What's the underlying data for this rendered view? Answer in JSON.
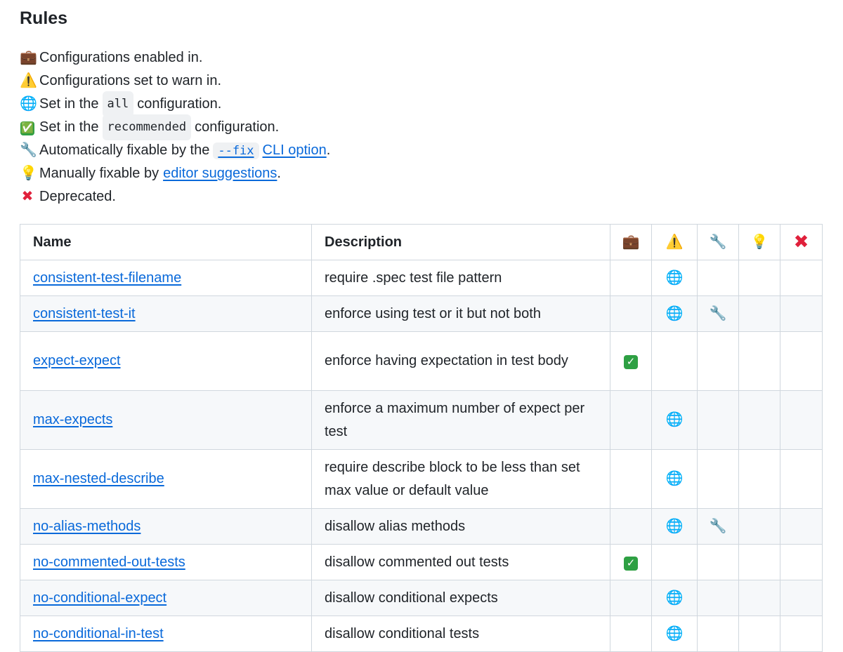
{
  "title": "Rules",
  "legend": [
    {
      "icon": "💼",
      "text": "Configurations enabled in."
    },
    {
      "icon": "⚠️",
      "text": "Configurations set to warn in."
    },
    {
      "icon": "🌐",
      "pre": "Set in the",
      "code": "all",
      "post": "configuration."
    },
    {
      "icon": "✅",
      "pre": "Set in the",
      "code": "recommended",
      "post": "configuration."
    },
    {
      "icon": "🔧",
      "pre": "Automatically fixable by the",
      "code_link": "--fix",
      "link": "CLI option",
      "post": "."
    },
    {
      "icon": "💡",
      "pre": "Manually fixable by",
      "link": "editor suggestions",
      "post": "."
    },
    {
      "icon": "✖",
      "text": "Deprecated."
    }
  ],
  "table": {
    "headers": {
      "name": "Name",
      "description": "Description",
      "c1": "💼",
      "c2": "⚠️",
      "c3": "🔧",
      "c4": "💡",
      "c5": "✖"
    },
    "rows": [
      {
        "name": "consistent-test-filename",
        "description": "require .spec test file pattern",
        "c2": "🌐"
      },
      {
        "name": "consistent-test-it",
        "description": "enforce using test or it but not both",
        "c2": "🌐",
        "c3": "🔧"
      },
      {
        "name": "expect-expect",
        "description": "enforce having expectation in test body",
        "c1": "✓"
      },
      {
        "name": "max-expects",
        "description": "enforce a maximum number of expect per test",
        "c2": "🌐"
      },
      {
        "name": "max-nested-describe",
        "description": "require describe block to be less than set max value or default value",
        "c2": "🌐"
      },
      {
        "name": "no-alias-methods",
        "description": "disallow alias methods",
        "c2": "🌐",
        "c3": "🔧"
      },
      {
        "name": "no-commented-out-tests",
        "description": "disallow commented out tests",
        "c1": "✓"
      },
      {
        "name": "no-conditional-expect",
        "description": "disallow conditional expects",
        "c2": "🌐"
      },
      {
        "name": "no-conditional-in-test",
        "description": "disallow conditional tests",
        "c2": "🌐"
      }
    ]
  }
}
